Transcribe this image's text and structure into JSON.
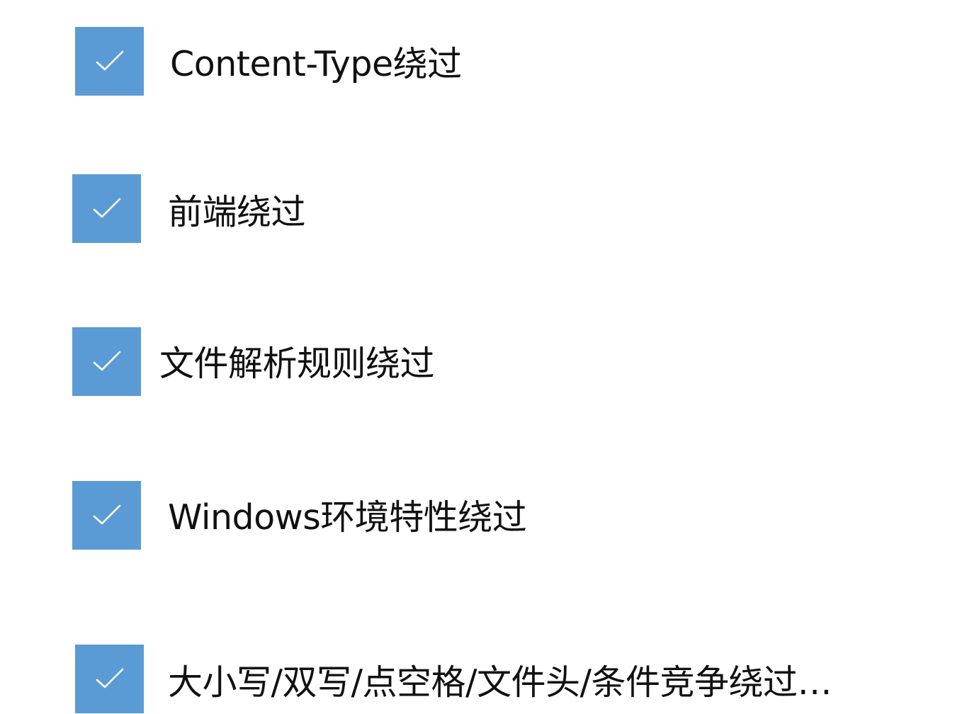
{
  "colors": {
    "checkbox_fill": "#5b9bd5",
    "checkmark": "#ffffff",
    "text": "#111111"
  },
  "checklist": {
    "items": [
      {
        "label": "Content-Type绕过",
        "checked": true,
        "icon": "checkmark-icon"
      },
      {
        "label": "前端绕过",
        "checked": true,
        "icon": "checkmark-icon"
      },
      {
        "label": "文件解析规则绕过",
        "checked": true,
        "icon": "checkmark-icon"
      },
      {
        "label": "Windows环境特性绕过",
        "checked": true,
        "icon": "checkmark-icon"
      },
      {
        "label": "大小写/双写/点空格/文件头/条件竞争绕过…",
        "checked": true,
        "icon": "checkmark-icon"
      }
    ]
  }
}
